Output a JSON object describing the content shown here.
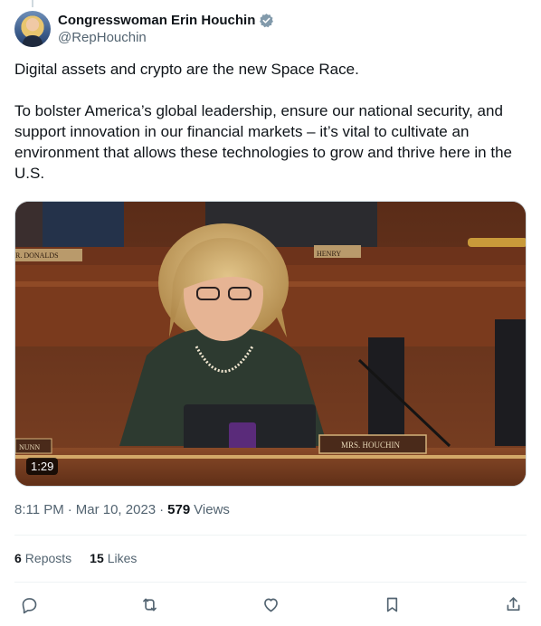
{
  "author": {
    "display_name": "Congresswoman Erin Houchin",
    "handle": "@RepHouchin",
    "verified_color": "#829aab"
  },
  "tweet": {
    "paragraphs": [
      "Digital assets and crypto are the new Space Race.",
      "To bolster America’s global leadership, ensure our national security, and support innovation in our financial markets – it’s vital to cultivate an environment that allows these technologies to grow and thrive here in the U.S."
    ]
  },
  "video": {
    "duration": "1:29",
    "nameplates": {
      "left_top": "R. DONALDS",
      "center_top": "HENRY",
      "left_bottom": "NUNN",
      "speaker": "MRS. HOUCHIN"
    }
  },
  "meta": {
    "time": "8:11 PM",
    "date": "Mar 10, 2023",
    "views_count": "579",
    "views_label": "Views"
  },
  "stats": {
    "reposts_count": "6",
    "reposts_label": "Reposts",
    "likes_count": "15",
    "likes_label": "Likes"
  },
  "actions": [
    "reply-icon",
    "repost-icon",
    "like-icon",
    "bookmark-icon",
    "share-icon"
  ],
  "colors": {
    "text": "#0f1419",
    "secondary": "#536471",
    "divider": "#eff3f4",
    "wood": "#6b3520"
  }
}
